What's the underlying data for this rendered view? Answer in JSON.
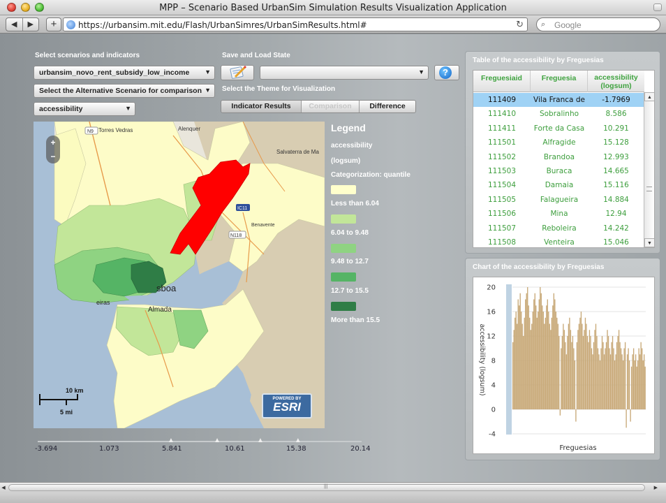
{
  "window": {
    "title": "MPP – Scenario Based UrbanSim Simulation Results Visualization Application"
  },
  "browser": {
    "back": "◀",
    "forward": "▶",
    "add": "+",
    "url": "https://urbansim.mit.edu/Flash/UrbanSimres/UrbanSimResults.html#",
    "reload": "↻",
    "search_placeholder": "Google",
    "search_icon": "⌕"
  },
  "controls": {
    "select_label": "Select scenarios and indicators",
    "scenario_value": "urbansim_novo_rent_subsidy_low_income",
    "alt_scenario_value": "Select the Alternative Scenario for comparison",
    "indicator_value": "accessibility",
    "save_load_label": "Save and Load State",
    "state_value": "",
    "theme_label": "Select the Theme for Visualization",
    "help_label": "?",
    "themes": [
      "Indicator Results",
      "Comparison",
      "Difference"
    ]
  },
  "map": {
    "zoom_in": "+",
    "zoom_out": "−",
    "scale_km": "10 km",
    "scale_mi": "5 mi",
    "esri_powered": "POWERED BY",
    "esri_logo": "ESRI",
    "places": [
      "Torres Vedras",
      "Alenquer",
      "Salvaterra de Ma",
      "Benavente",
      "sboa",
      "Almada",
      "eiras",
      "N9",
      "IC11",
      "N118"
    ]
  },
  "legend": {
    "title": "Legend",
    "line1": "accessibility",
    "line2": "(logsum)",
    "line3": "Categorization: quantile",
    "items": [
      {
        "label": "Less than 6.04",
        "color": "#ffffcc"
      },
      {
        "label": "6.04 to 9.48",
        "color": "#c2e699"
      },
      {
        "label": "9.48 to 12.7",
        "color": "#8fd382"
      },
      {
        "label": "12.7 to 15.5",
        "color": "#55b465"
      },
      {
        "label": "More than 15.5",
        "color": "#2f7d46"
      }
    ]
  },
  "slider": {
    "ticks": [
      "-3.694",
      "1.073",
      "5.841",
      "10.61",
      "15.38",
      "20.14"
    ],
    "thumb_values": [
      6.04,
      9.48,
      12.7,
      15.5
    ],
    "min": -3.694,
    "max": 20.14
  },
  "table": {
    "title": "Table of the accessibility by Freguesias",
    "columns": [
      "Freguesiaid",
      "Freguesia",
      "accessibility (logsum)"
    ],
    "rows": [
      [
        "111409",
        "Vila Franca de",
        "-1.7969"
      ],
      [
        "111410",
        "Sobralinho",
        "8.586"
      ],
      [
        "111411",
        "Forte da Casa",
        "10.291"
      ],
      [
        "111501",
        "Alfragide",
        "15.128"
      ],
      [
        "111502",
        "Brandoa",
        "12.993"
      ],
      [
        "111503",
        "Buraca",
        "14.665"
      ],
      [
        "111504",
        "Damaia",
        "15.116"
      ],
      [
        "111505",
        "Falagueira",
        "14.884"
      ],
      [
        "111506",
        "Mina",
        "12.94"
      ],
      [
        "111507",
        "Reboleira",
        "14.242"
      ],
      [
        "111508",
        "Venteira",
        "15.046"
      ]
    ],
    "selected_index": 0
  },
  "chart": {
    "title": "Chart of the accessibility by Freguesias",
    "bar_color": "#c8a978"
  },
  "chart_data": {
    "type": "bar",
    "title": "",
    "xlabel": "Freguesias",
    "ylabel": "accessibility (logsum)",
    "ylim": [
      -4,
      20
    ],
    "yticks": [
      20,
      16,
      12,
      8,
      4,
      0,
      -4
    ],
    "grid": true,
    "values": [
      11,
      13,
      15,
      16,
      14,
      18,
      17,
      19,
      16,
      14,
      12,
      15,
      18,
      19,
      20,
      17,
      15,
      13,
      14,
      16,
      18,
      19,
      17,
      15,
      16,
      18,
      20,
      19,
      17,
      16,
      14,
      15,
      17,
      18,
      16,
      14,
      13,
      15,
      17,
      19,
      18,
      16,
      15,
      14,
      12,
      -1,
      10,
      12,
      14,
      13,
      11,
      9,
      12,
      14,
      15,
      13,
      11,
      12,
      10,
      8,
      -2,
      11,
      13,
      14,
      15,
      16,
      14,
      12,
      13,
      15,
      14,
      12,
      11,
      13,
      12,
      10,
      9,
      11,
      13,
      14,
      12,
      10,
      9,
      8,
      10,
      12,
      11,
      9,
      10,
      11,
      13,
      12,
      10,
      9,
      11,
      12,
      10,
      8,
      9,
      11,
      12,
      13,
      11,
      10,
      9,
      8,
      10,
      11,
      -3,
      9,
      10,
      8,
      -2,
      7,
      9,
      10,
      8,
      9,
      7,
      8,
      10,
      9,
      11,
      10,
      8,
      9,
      7
    ]
  }
}
